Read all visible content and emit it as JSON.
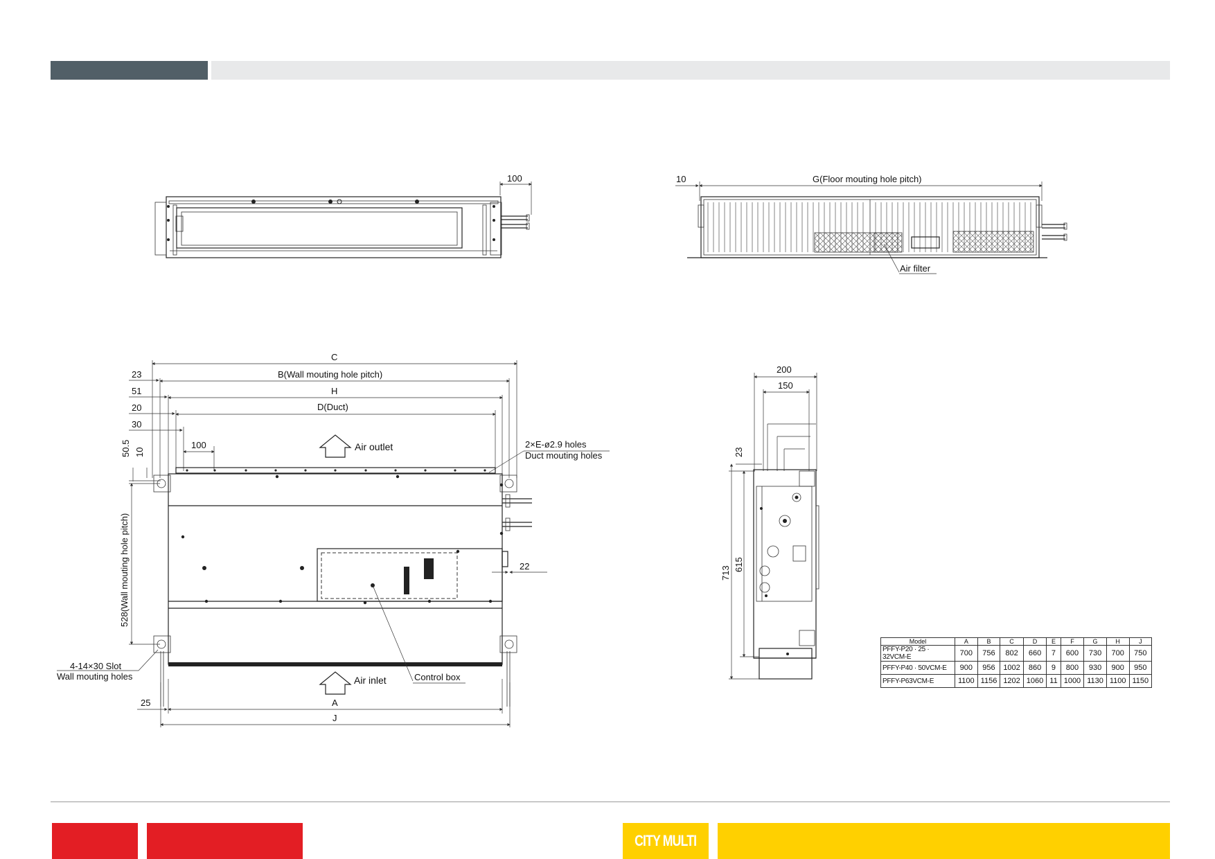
{
  "drawing_labels": {
    "top_left_dim_100": "100",
    "top_right_dim_10": "10",
    "top_right_g": "G(Floor mouting hole pitch)",
    "air_filter": "Air filter",
    "dim_c": "C",
    "dim_b": "B(Wall mouting hole pitch)",
    "dim_h": "H",
    "dim_d": "D(Duct)",
    "dim_23": "23",
    "dim_51": "51",
    "dim_20": "20",
    "dim_30": "30",
    "dim_50_5": "50.5",
    "dim_10": "10",
    "dim_100": "100",
    "air_outlet": "Air outlet",
    "holes_1": "2×E-ø2.9 holes",
    "holes_2": "Duct mouting holes",
    "dim_22": "22",
    "wall_pitch_528": "528(Wall mouting hole pitch)",
    "slot_1": "4-14×30 Slot",
    "slot_2": "Wall mouting holes",
    "air_inlet": "Air inlet",
    "control_box": "Control box",
    "dim_25": "25",
    "dim_a": "A",
    "dim_j": "J",
    "side_200": "200",
    "side_150": "150",
    "side_23": "23",
    "side_713": "713",
    "side_615": "615"
  },
  "table": {
    "headers": [
      "Model",
      "A",
      "B",
      "C",
      "D",
      "E",
      "F",
      "G",
      "H",
      "J"
    ],
    "rows": [
      [
        "PFFY-P20 · 25 · 32VCM-E",
        "700",
        "756",
        "802",
        "660",
        "7",
        "600",
        "730",
        "700",
        "750"
      ],
      [
        "PFFY-P40 · 50VCM-E",
        "900",
        "956",
        "1002",
        "860",
        "9",
        "800",
        "930",
        "900",
        "950"
      ],
      [
        "PFFY-P63VCM-E",
        "1100",
        "1156",
        "1202",
        "1060",
        "11",
        "1000",
        "1130",
        "1100",
        "1150"
      ]
    ]
  },
  "footer": {
    "logo_text": "CITY MULTI"
  },
  "colors": {
    "header_dark": "#515f67",
    "header_light": "#e8e9ea",
    "footer_red": "#e31e24",
    "footer_yellow": "#ffd000"
  }
}
